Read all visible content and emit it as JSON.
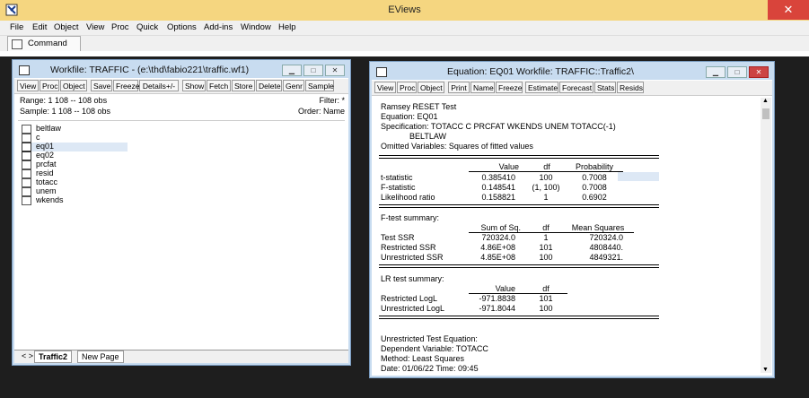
{
  "app": {
    "title": "EViews",
    "close_glyph": "✕"
  },
  "menu": [
    "File",
    "Edit",
    "Object",
    "View",
    "Proc",
    "Quick",
    "Options",
    "Add-ins",
    "Window",
    "Help"
  ],
  "command": {
    "label": "Command"
  },
  "workfile": {
    "title": "Workfile: TRAFFIC - (e:\\thd\\fabio221\\traffic.wf1)",
    "toolbar": [
      "View",
      "Proc",
      "Object",
      "Save",
      "Freeze",
      "Details+/-",
      "Show",
      "Fetch",
      "Store",
      "Delete",
      "Genr",
      "Sample"
    ],
    "range": "Range:  1 108  --  108 obs",
    "sample": "Sample: 1 108  --  108 obs",
    "filter": "Filter: *",
    "order": "Order: Name",
    "objects": [
      "beltlaw",
      "c",
      "eq01",
      "eq02",
      "prcfat",
      "resid",
      "totacc",
      "unem",
      "wkends"
    ],
    "tabs": [
      "Traffic2",
      "New Page"
    ]
  },
  "equation": {
    "title": "Equation: EQ01   Workfile: TRAFFIC::Traffic2\\",
    "toolbar": [
      "View",
      "Proc",
      "Object",
      "Print",
      "Name",
      "Freeze",
      "Estimate",
      "Forecast",
      "Stats",
      "Resids"
    ],
    "header": {
      "l1": "Ramsey RESET Test",
      "l2": "Equation: EQ01",
      "l3": "Specification: TOTACC C  PRCFAT WKENDS UNEM TOTACC(-1)",
      "l4": "BELTLAW",
      "l5": "Omitted Variables: Squares of fitted values"
    },
    "stats": {
      "cols": [
        "Value",
        "df",
        "Probability"
      ],
      "rows": [
        [
          "t-statistic",
          "0.385410",
          "100",
          "0.7008"
        ],
        [
          "F-statistic",
          "0.148541",
          "(1, 100)",
          "0.7008"
        ],
        [
          "Likelihood ratio",
          "0.158821",
          "1",
          "0.6902"
        ]
      ]
    },
    "ftest": {
      "title": "F-test summary:",
      "cols": [
        "Sum of Sq.",
        "df",
        "Mean Squares"
      ],
      "rows": [
        [
          "Test SSR",
          "720324.0",
          "1",
          "720324.0"
        ],
        [
          "Restricted SSR",
          "4.86E+08",
          "101",
          "4808440."
        ],
        [
          "Unrestricted SSR",
          "4.85E+08",
          "100",
          "4849321."
        ]
      ]
    },
    "lrtest": {
      "title": "LR test summary:",
      "cols": [
        "Value",
        "df"
      ],
      "rows": [
        [
          "Restricted LogL",
          "-971.8838",
          "101"
        ],
        [
          "Unrestricted LogL",
          "-971.8044",
          "100"
        ]
      ]
    },
    "footer": {
      "l1": "Unrestricted Test Equation:",
      "l2": "Dependent Variable: TOTACC",
      "l3": "Method: Least Squares",
      "l4": "Date: 01/06/22   Time: 09:45"
    }
  }
}
